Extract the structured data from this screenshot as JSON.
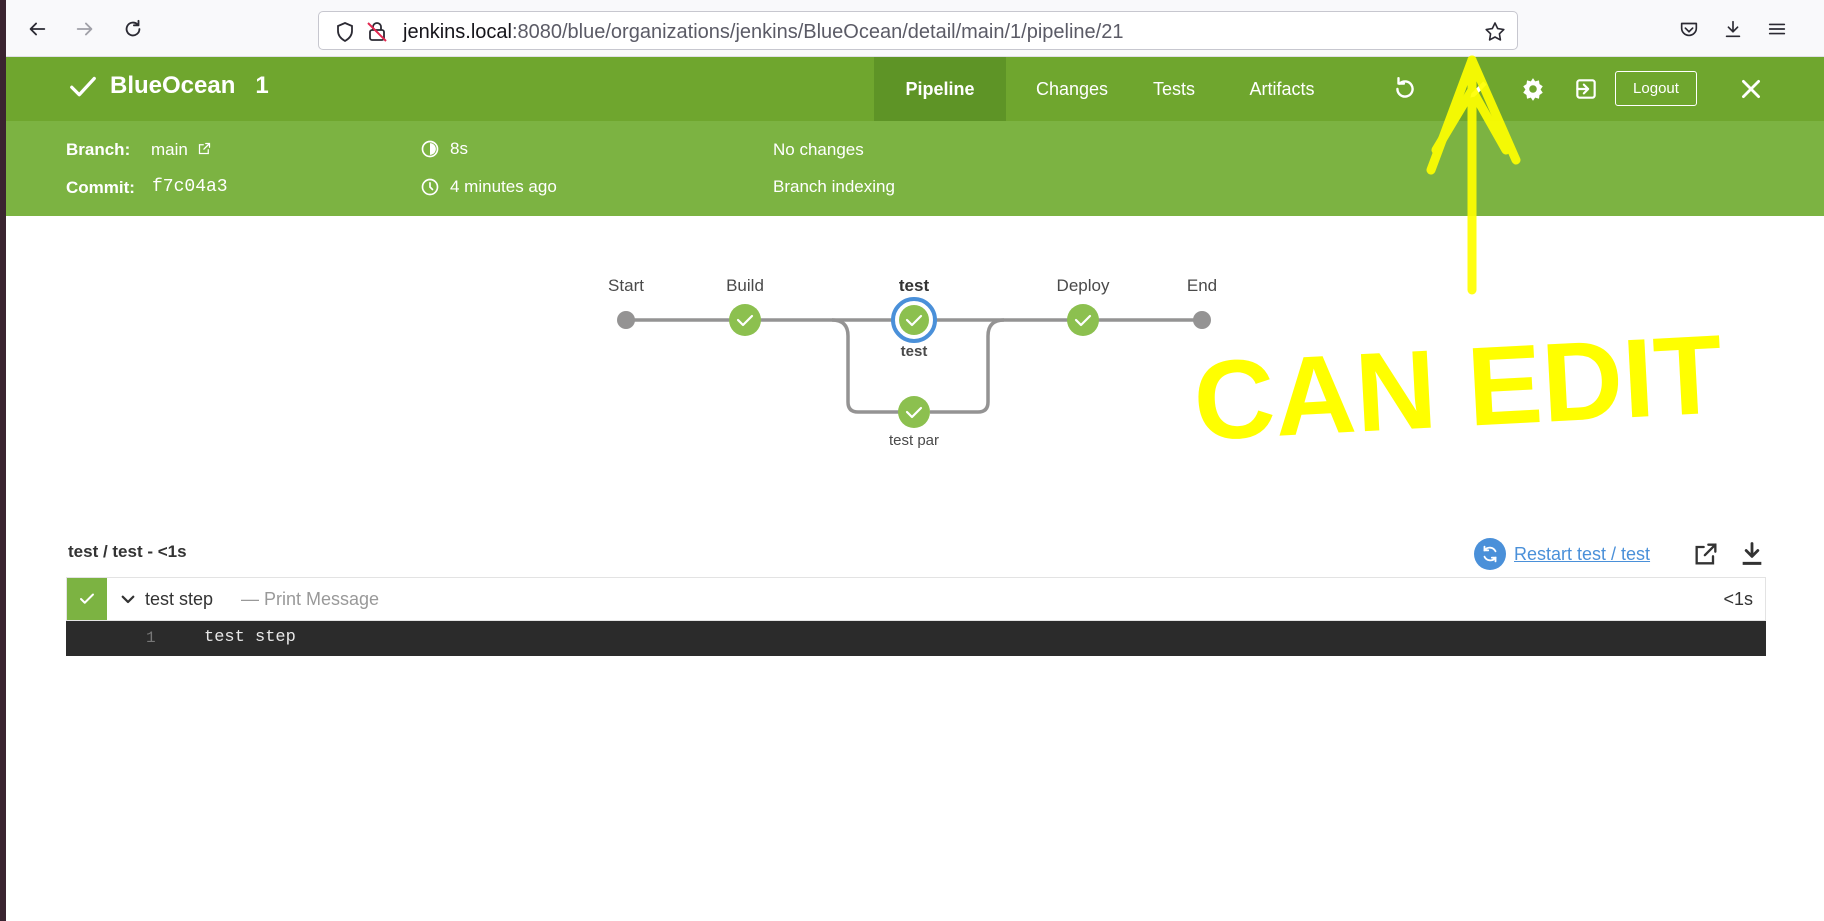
{
  "browser": {
    "url_host": "jenkins.local",
    "url_path": ":8080/blue/organizations/jenkins/BlueOcean/detail/main/1/pipeline/21"
  },
  "header": {
    "title": "BlueOcean",
    "run_number": "1",
    "tabs": [
      {
        "label": "Pipeline",
        "active": true
      },
      {
        "label": "Changes",
        "active": false
      },
      {
        "label": "Tests",
        "active": false
      },
      {
        "label": "Artifacts",
        "active": false
      }
    ],
    "icons": [
      "replay-icon",
      "edit-icon",
      "settings-icon",
      "exit-to-app-icon",
      "close-icon"
    ],
    "logout_label": "Logout",
    "accent_color": "#6fa62e"
  },
  "run_meta": {
    "branch_label": "Branch:",
    "branch_value": "main",
    "commit_label": "Commit:",
    "commit_value": "f7c04a3",
    "duration": "8s",
    "started": "4 minutes ago",
    "changes": "No changes",
    "cause": "Branch indexing"
  },
  "pipeline": {
    "stages": [
      {
        "label": "Start",
        "status": "none"
      },
      {
        "label": "Build",
        "status": "success"
      },
      {
        "label": "test",
        "status": "success",
        "selected": true,
        "parallel": [
          {
            "label": "test",
            "status": "success",
            "selected": true
          },
          {
            "label": "test par",
            "status": "success"
          }
        ]
      },
      {
        "label": "Deploy",
        "status": "success"
      },
      {
        "label": "End",
        "status": "none"
      }
    ]
  },
  "log": {
    "title": "test / test - <1s",
    "restart_label": "Restart test / test",
    "step": {
      "name": "test step",
      "description": "— Print Message",
      "duration": "<1s",
      "status": "success"
    },
    "lines": [
      {
        "number": "1",
        "text": "test step"
      }
    ]
  },
  "annotation": {
    "text": "CAN EDIT",
    "color": "#ffff00"
  }
}
